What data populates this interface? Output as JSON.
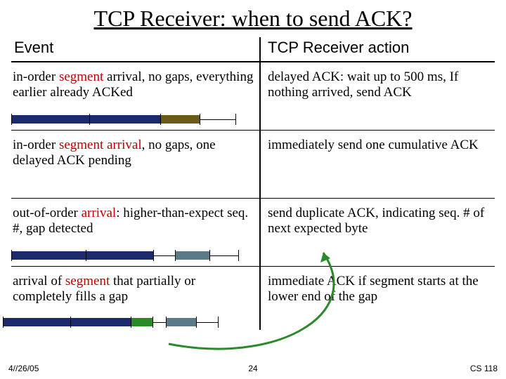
{
  "title": "TCP Receiver: when to send ACK?",
  "headers": {
    "event": "Event",
    "action": "TCP Receiver action"
  },
  "rows": [
    {
      "event_pre": "in-order ",
      "event_hl": "segment",
      "event_post": " arrival, no gaps, everything earlier already ACKed",
      "action": "delayed ACK: wait up to 500 ms, If nothing arrived, send ACK"
    },
    {
      "event_pre": "in-order ",
      "event_hl": "segment arrival",
      "event_post": ", no gaps, one delayed ACK pending",
      "action": "immediately send one cumulative ACK"
    },
    {
      "event_pre": "out-of-order ",
      "event_hl": "arrival",
      "event_post": ": higher-than-expect seq. #, gap detected",
      "action": "send duplicate ACK, indicating seq. # of next expected byte"
    },
    {
      "event_pre": "arrival of ",
      "event_hl": "segment",
      "event_post": " that partially or completely fills a gap",
      "action": "immediate ACK if segment starts at the lower end of the gap"
    }
  ],
  "footer": {
    "date": "4//26/05",
    "page": "24",
    "course": "CS 118"
  },
  "colors": {
    "navy": "#1a2a6c",
    "olive": "#6b5b1a",
    "green": "#2a8a2a",
    "slate": "#5a7a8a"
  }
}
